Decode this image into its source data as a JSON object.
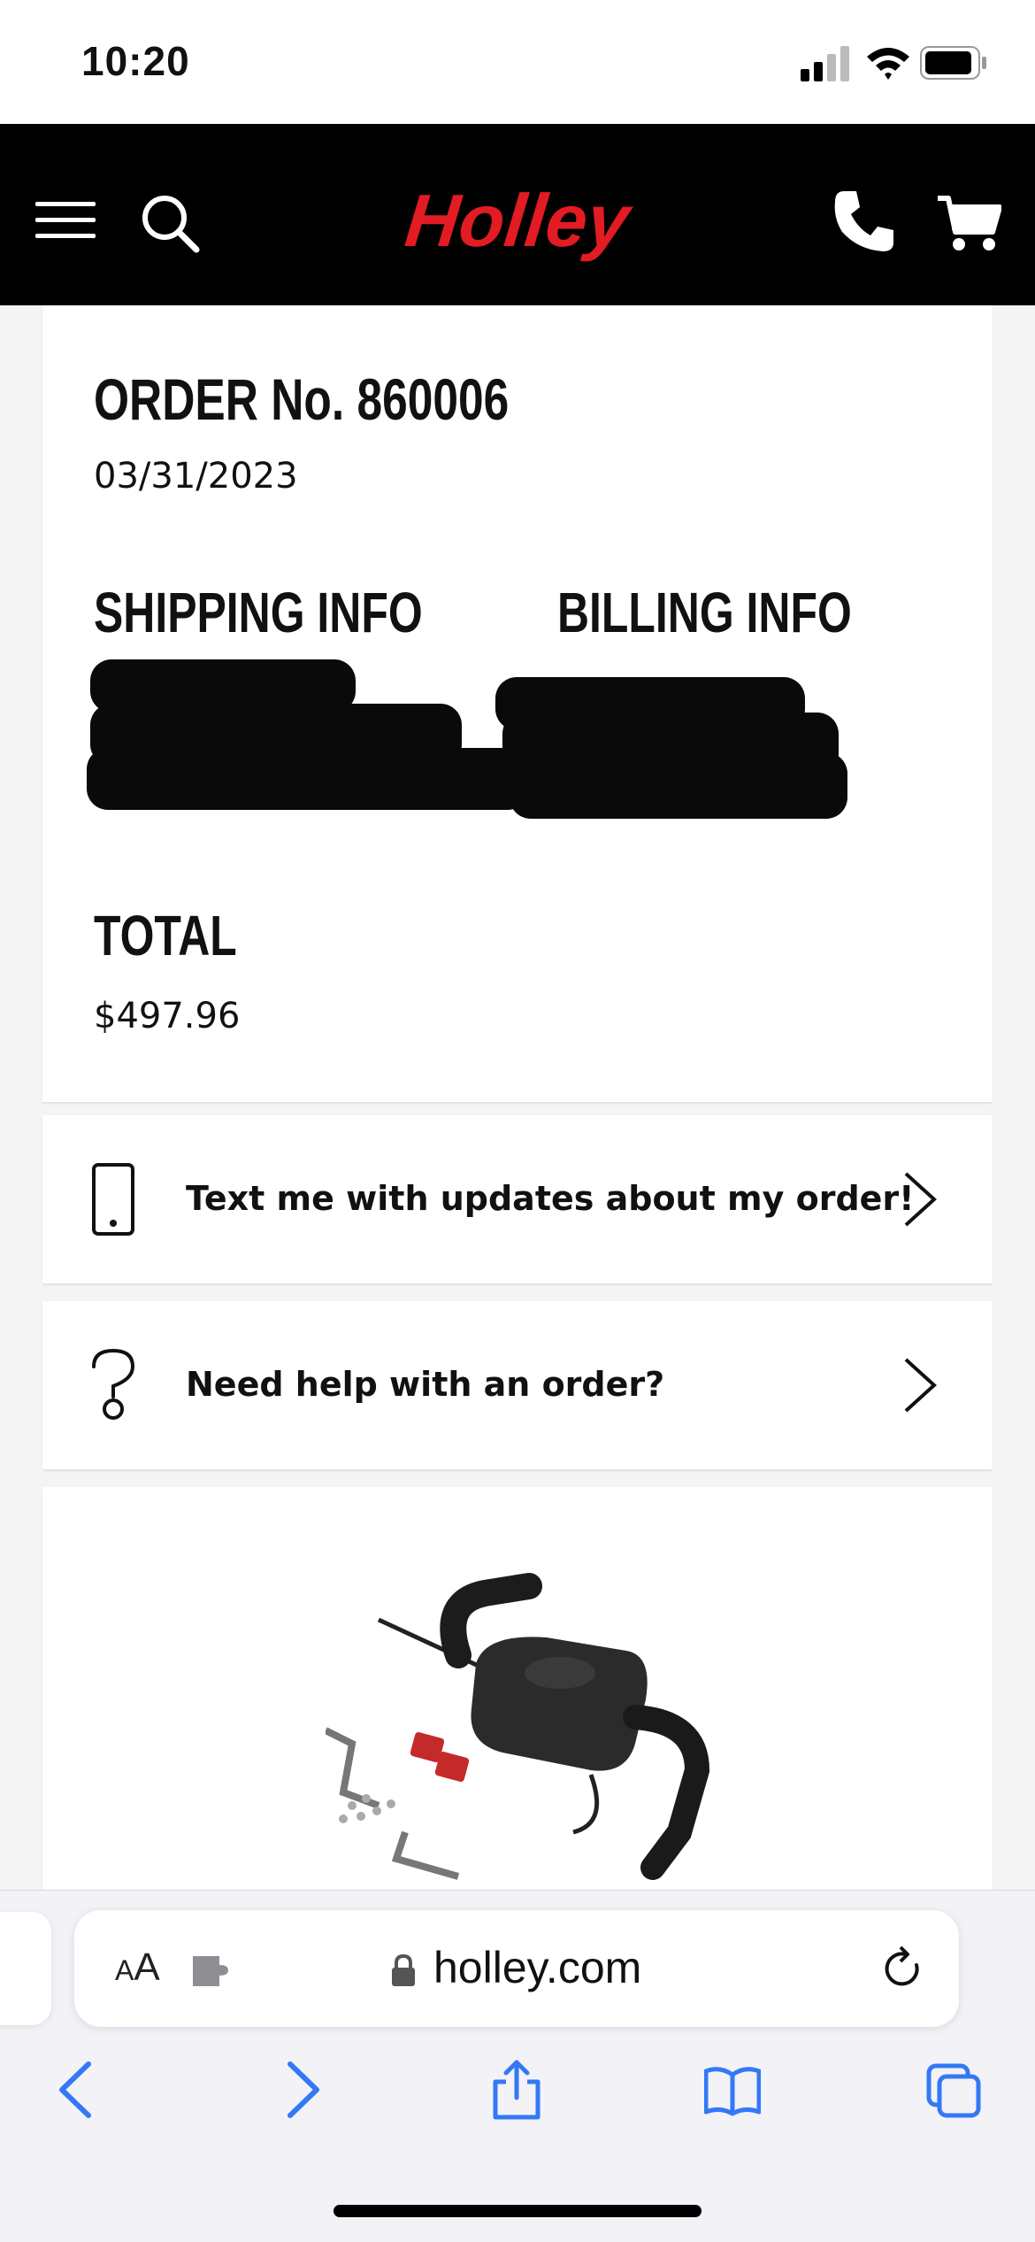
{
  "status_bar": {
    "time": "10:20"
  },
  "header": {
    "brand": "Holley"
  },
  "order": {
    "title": "ORDER No. 860006",
    "date": "03/31/2023",
    "shipping_title": "SHIPPING INFO",
    "billing_title": "BILLING INFO",
    "total_title": "TOTAL",
    "total_value": "$497.96"
  },
  "actions": {
    "text_updates": "Text me with updates about my order!",
    "help": "Need help with an order?"
  },
  "browser": {
    "aa_small": "A",
    "aa_large": "A",
    "domain": "holley.com"
  },
  "colors": {
    "brand_red": "#e31b23",
    "header_bg": "#000000",
    "safari_blue": "#3478f6"
  }
}
